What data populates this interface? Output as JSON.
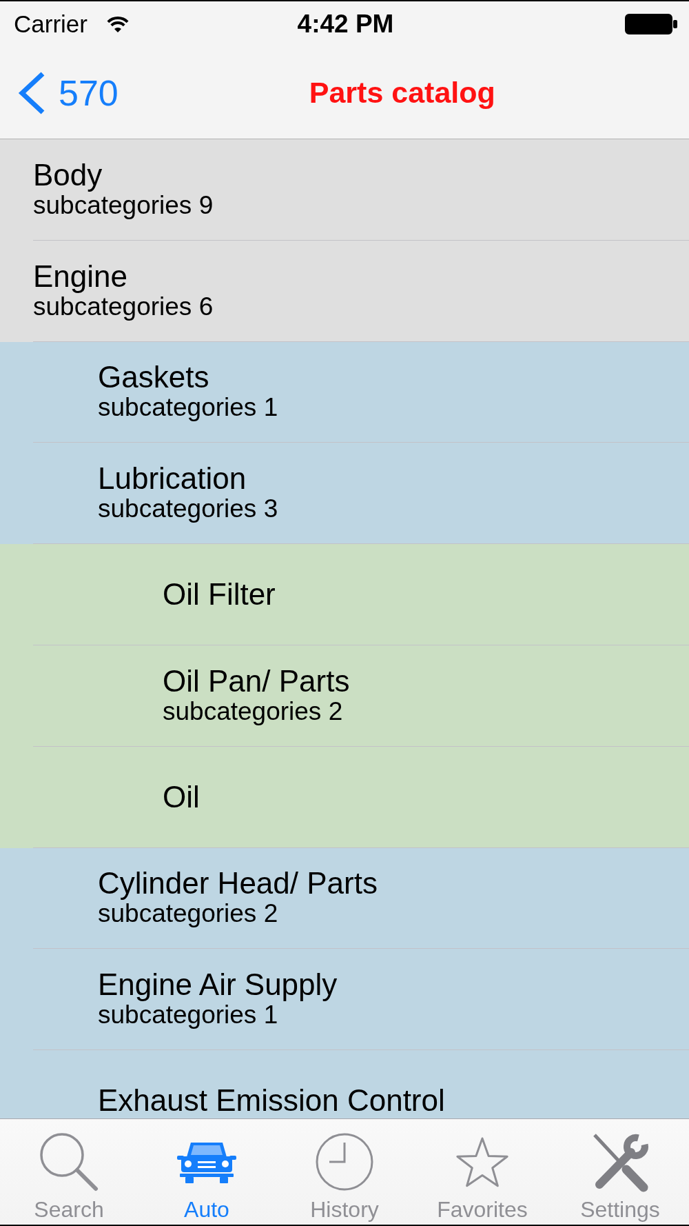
{
  "status_bar": {
    "carrier": "Carrier",
    "time": "4:42 PM"
  },
  "nav_bar": {
    "back_label": "570",
    "title": "Parts catalog"
  },
  "categories": [
    {
      "title": "Body",
      "subtitle": "subcategories 9"
    },
    {
      "title": "Engine",
      "subtitle": "subcategories 6",
      "children": [
        {
          "title": "Gaskets",
          "subtitle": "subcategories 1"
        },
        {
          "title": "Lubrication",
          "subtitle": "subcategories 3",
          "children": [
            {
              "title": "Oil Filter"
            },
            {
              "title": "Oil Pan/ Parts",
              "subtitle": "subcategories 2"
            },
            {
              "title": "Oil"
            }
          ]
        },
        {
          "title": "Cylinder Head/ Parts",
          "subtitle": "subcategories 2"
        },
        {
          "title": "Engine Air Supply",
          "subtitle": "subcategories 1"
        },
        {
          "title": "Exhaust Emission Control"
        }
      ]
    }
  ],
  "tab_bar": [
    {
      "kind": "search",
      "label": "Search",
      "selected": false
    },
    {
      "kind": "car",
      "label": "Auto",
      "selected": true
    },
    {
      "kind": "clock",
      "label": "History",
      "selected": false
    },
    {
      "kind": "star",
      "label": "Favorites",
      "selected": false
    },
    {
      "kind": "tools",
      "label": "Settings",
      "selected": false
    }
  ]
}
